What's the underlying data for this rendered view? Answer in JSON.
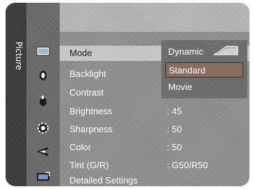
{
  "sidebar": {
    "tab_label": "Picture"
  },
  "menu_icons": [
    "picture-icon",
    "sound-icon",
    "channel-icon",
    "setup-icon",
    "input-icon",
    "support-icon",
    "guide-icon"
  ],
  "menu": {
    "items": [
      {
        "label": "Mode",
        "value": ""
      },
      {
        "label": "Backlight",
        "value": ""
      },
      {
        "label": "Contrast",
        "value": ""
      },
      {
        "label": "Brightness",
        "value": ": 45"
      },
      {
        "label": "Sharpness",
        "value": ": 50"
      },
      {
        "label": "Color",
        "value": ": 50"
      },
      {
        "label": "Tint (G/R)",
        "value": ": G50/R50"
      },
      {
        "label": "Detailed Settings",
        "value": ""
      }
    ]
  },
  "mode_popup": {
    "options": [
      "Dynamic",
      "Standard",
      "Movie"
    ],
    "selected": "Standard"
  }
}
